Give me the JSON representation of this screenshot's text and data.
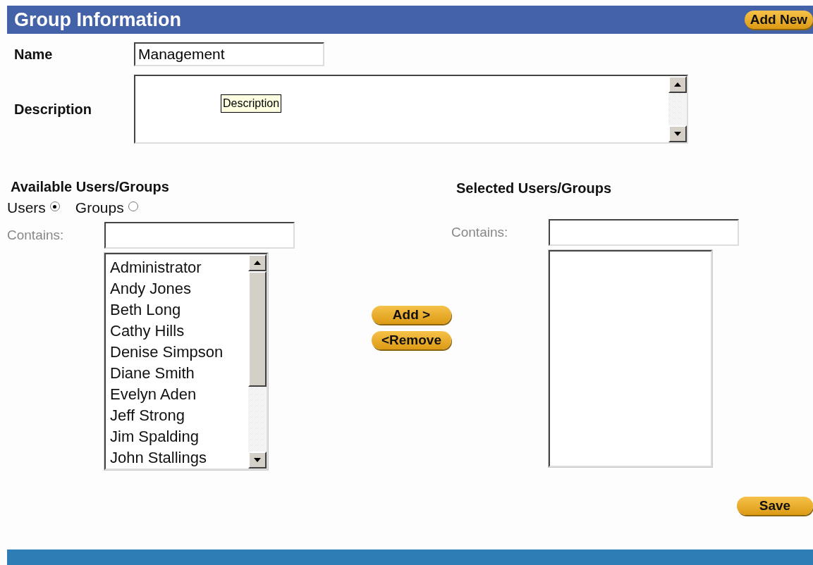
{
  "header": {
    "title": "Group Information",
    "add_button": "Add New"
  },
  "name_field": {
    "label": "Name",
    "value": "Management"
  },
  "description_field": {
    "label": "Description",
    "tooltip": "Description"
  },
  "available": {
    "title": "Available Users/Groups",
    "filter_options": [
      {
        "label": "Users",
        "selected": true
      },
      {
        "label": "Groups",
        "selected": false
      }
    ],
    "contains_label": "Contains:",
    "items": [
      "Administrator",
      "Andy Jones",
      "Beth Long",
      "Cathy Hills",
      "Denise Simpson",
      "Diane Smith",
      "Evelyn Aden",
      "Jeff Strong",
      "Jim Spalding",
      "John Stallings"
    ]
  },
  "transfer_buttons": [
    "Add >",
    "<Remove"
  ],
  "selected": {
    "title": "Selected Users/Groups",
    "contains_label": "Contains:"
  },
  "save_button": "Save"
}
